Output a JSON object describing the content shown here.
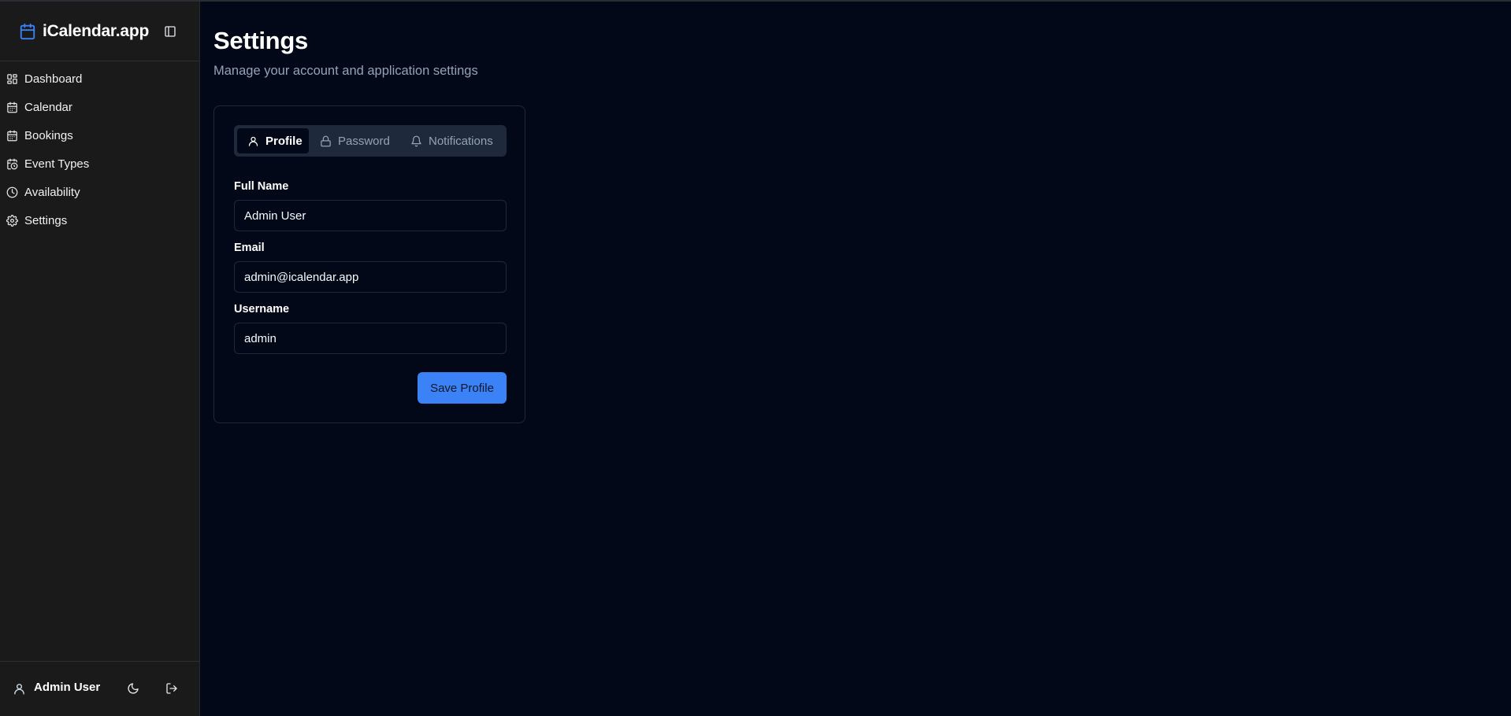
{
  "app": {
    "title": "iCalendar.app"
  },
  "sidebar": {
    "items": [
      {
        "label": "Dashboard",
        "icon": "dashboard-icon"
      },
      {
        "label": "Calendar",
        "icon": "calendar-icon"
      },
      {
        "label": "Bookings",
        "icon": "calendar-icon"
      },
      {
        "label": "Event Types",
        "icon": "calendar-clock-icon"
      },
      {
        "label": "Availability",
        "icon": "clock-icon"
      },
      {
        "label": "Settings",
        "icon": "gear-icon"
      }
    ],
    "footer": {
      "user_name": "Admin User"
    }
  },
  "page": {
    "title": "Settings",
    "subtitle": "Manage your account and application settings"
  },
  "tabs": [
    {
      "label": "Profile",
      "icon": "user-icon",
      "active": true
    },
    {
      "label": "Password",
      "icon": "lock-icon",
      "active": false
    },
    {
      "label": "Notifications",
      "icon": "bell-icon",
      "active": false
    }
  ],
  "form": {
    "full_name": {
      "label": "Full Name",
      "value": "Admin User"
    },
    "email": {
      "label": "Email",
      "value": "admin@icalendar.app"
    },
    "username": {
      "label": "Username",
      "value": "admin"
    },
    "save_label": "Save Profile"
  },
  "colors": {
    "background": "#020817",
    "sidebar": "#1a1a1a",
    "accent": "#3b82f6",
    "muted_text": "#94a3b8",
    "border": "#1e293b"
  }
}
